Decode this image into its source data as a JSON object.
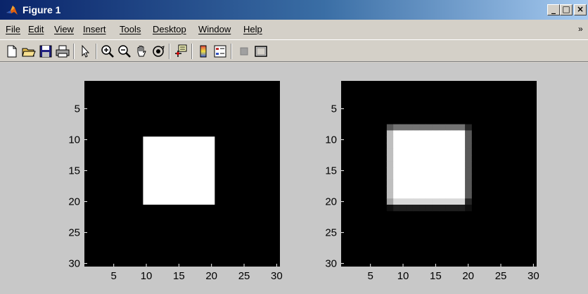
{
  "window": {
    "title": "Figure 1",
    "min_symbol": "_",
    "max_symbol": "□",
    "close_symbol": "×"
  },
  "menu": {
    "items": [
      "File",
      "Edit",
      "View",
      "Insert",
      "Tools",
      "Desktop",
      "Window",
      "Help"
    ],
    "overflow_symbol": "»"
  },
  "toolbar": {
    "buttons": [
      "new-figure",
      "open-file",
      "save",
      "print",
      "pointer-arrow",
      "zoom-in",
      "zoom-out",
      "pan-hand",
      "rotate-3d",
      "data-cursor",
      "insert-colorbar",
      "insert-legend",
      "hide-plot-tools",
      "show-plot-tools"
    ]
  },
  "colors": {
    "figure_bg": "#c8c8c8",
    "axes_bg": "#000000",
    "title_bar_start": "#0a246a",
    "title_bar_end": "#a6caf0"
  },
  "chart_data": [
    {
      "type": "heatmap",
      "title": "",
      "colormap": "gray",
      "xlim": [
        0.5,
        30.5
      ],
      "ylim": [
        30.5,
        0.5
      ],
      "xticks": [
        5,
        10,
        15,
        20,
        25,
        30
      ],
      "yticks": [
        5,
        10,
        15,
        20,
        25,
        30
      ],
      "x_tick_labels": [
        "5",
        "10",
        "15",
        "20",
        "25",
        "30"
      ],
      "y_tick_labels": [
        "5",
        "10",
        "15",
        "20",
        "25",
        "30"
      ],
      "background_value": 0,
      "white_region": {
        "rows": [
          10,
          20
        ],
        "cols": [
          10,
          20
        ],
        "value": 1
      }
    },
    {
      "type": "heatmap",
      "title": "",
      "colormap": "gray",
      "xlim": [
        0.5,
        30.5
      ],
      "ylim": [
        30.5,
        0.5
      ],
      "xticks": [
        5,
        10,
        15,
        20,
        25,
        30
      ],
      "yticks": [
        5,
        10,
        15,
        20,
        25,
        30
      ],
      "x_tick_labels": [
        "5",
        "10",
        "15",
        "20",
        "25",
        "30"
      ],
      "y_tick_labels": [
        "5",
        "10",
        "15",
        "20",
        "25",
        "30"
      ],
      "background_value": 0,
      "white_region": {
        "rows": [
          8,
          20
        ],
        "cols": [
          8,
          19
        ],
        "value": 1,
        "blurred_edges": true
      }
    }
  ]
}
